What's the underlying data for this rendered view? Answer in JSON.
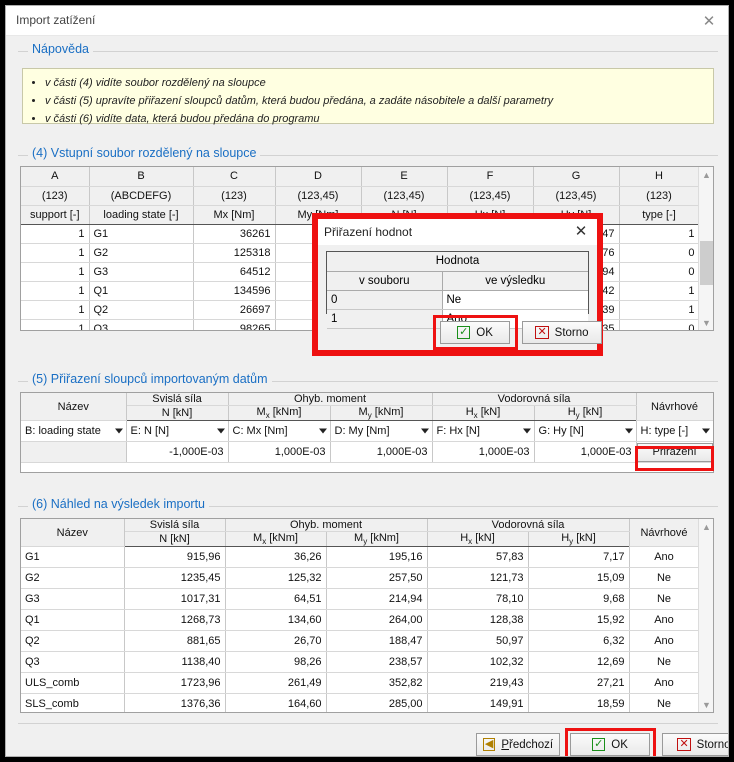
{
  "window": {
    "title": "Import zatížení",
    "close_icon": "close-icon"
  },
  "help": {
    "legend": "Nápověda",
    "items": [
      "v části (4) vidíte soubor rozdělený na sloupce",
      "v části (5) upravíte přiřazení sloupců datům, která budou předána, a zadáte násobitele a další parametry",
      "v části (6) vidíte data, která budou předána do programu"
    ]
  },
  "section4": {
    "legend": "(4) Vstupní soubor rozdělený na sloupce",
    "header_letters": [
      "A",
      "B",
      "C",
      "D",
      "E",
      "F",
      "G",
      "H"
    ],
    "header_formats": [
      "(123)",
      "(ABCDEFG)",
      "(123)",
      "(123,45)",
      "(123,45)",
      "(123,45)",
      "(123,45)",
      "(123)"
    ],
    "header_names": [
      "support [-]",
      "loading state [-]",
      "Mx [Nm]",
      "My [Nm]",
      "N [N]",
      "Hx [N]",
      "Hy [N]",
      "type [-]"
    ],
    "rows": [
      [
        "1",
        "G1",
        "36261",
        "",
        "",
        "",
        ",86947",
        "1"
      ],
      [
        "1",
        "G2",
        "125318",
        "",
        "",
        "",
        ",27076",
        "0"
      ],
      [
        "1",
        "G3",
        "64512",
        "",
        "",
        "",
        ",36094",
        "0"
      ],
      [
        "1",
        "Q1",
        "134596",
        "",
        "",
        "",
        ",73442",
        "1"
      ],
      [
        "1",
        "Q2",
        "26697",
        "",
        "",
        "",
        ",96039",
        "1"
      ],
      [
        "1",
        "Q3",
        "98265",
        "",
        "",
        "",
        ",36535",
        "0"
      ]
    ],
    "scroll_up_icon": "chevron-up-icon",
    "scroll_down_icon": "chevron-down-icon"
  },
  "modal": {
    "title": "Přiřazení hodnot",
    "close_icon": "close-icon",
    "group_header": "Hodnota",
    "col_source": "v souboru",
    "col_result": "ve výsledku",
    "rows": [
      {
        "source": "0",
        "result": "Ne"
      },
      {
        "source": "1",
        "result": "Ano"
      }
    ],
    "ok_label": "OK",
    "cancel_label": "Storno",
    "ok_icon": "checkbox-checked-icon",
    "cancel_icon": "checkbox-x-icon"
  },
  "section5": {
    "legend": "(5) Přiřazení sloupců importovaným datům",
    "group_headers": [
      "Název",
      "Svislá síla",
      "Ohyb. moment",
      "Vodorovná síla",
      "Návrhové"
    ],
    "unit_headers": [
      "",
      "N [kN]",
      "Mx [kNm]",
      "My [kNm]",
      "Hx [kN]",
      "Hy [kN]",
      ""
    ],
    "mapping": [
      "B: loading state",
      "E: N [N]",
      "C: Mx [Nm]",
      "D: My [Nm]",
      "F: Hx [N]",
      "G: Hy [N]",
      "H: type [-]"
    ],
    "multipliers": [
      "",
      "-1,000E-03",
      "1,000E-03",
      "1,000E-03",
      "1,000E-03",
      "1,000E-03"
    ],
    "assign_button": "Přiřazení"
  },
  "section6": {
    "legend": "(6) Náhled na výsledek importu",
    "group_headers": [
      "Název",
      "Svislá síla",
      "Ohyb. moment",
      "Vodorovná síla",
      "Návrhové"
    ],
    "unit_headers": [
      "",
      "N [kN]",
      "Mx [kNm]",
      "My [kNm]",
      "Hx [kN]",
      "Hy [kN]",
      ""
    ],
    "rows": [
      [
        "G1",
        "915,96",
        "36,26",
        "195,16",
        "57,83",
        "7,17",
        "Ano"
      ],
      [
        "G2",
        "1235,45",
        "125,32",
        "257,50",
        "121,73",
        "15,09",
        "Ne"
      ],
      [
        "G3",
        "1017,31",
        "64,51",
        "214,94",
        "78,10",
        "9,68",
        "Ne"
      ],
      [
        "Q1",
        "1268,73",
        "134,60",
        "264,00",
        "128,38",
        "15,92",
        "Ano"
      ],
      [
        "Q2",
        "881,65",
        "26,70",
        "188,47",
        "50,97",
        "6,32",
        "Ano"
      ],
      [
        "Q3",
        "1138,40",
        "98,26",
        "238,57",
        "102,32",
        "12,69",
        "Ne"
      ],
      [
        "ULS_comb",
        "1723,96",
        "261,49",
        "352,82",
        "219,43",
        "27,21",
        "Ano"
      ],
      [
        "SLS_comb",
        "1376,36",
        "164,60",
        "285,00",
        "149,91",
        "18,59",
        "Ne"
      ]
    ],
    "scroll_up_icon": "chevron-up-icon",
    "scroll_down_icon": "chevron-down-icon"
  },
  "footer": {
    "prev_label": "Předchozí",
    "prev_mnemonic": "P",
    "prev_rest": "ředchozí",
    "ok_label": "OK",
    "cancel_label": "Storno",
    "prev_icon": "arrow-left-icon",
    "ok_icon": "checkbox-checked-icon",
    "cancel_icon": "checkbox-x-icon"
  },
  "colors": {
    "highlight": "#ee1111",
    "legend_blue": "#1a6fc4",
    "help_bg": "#ffffe1"
  }
}
